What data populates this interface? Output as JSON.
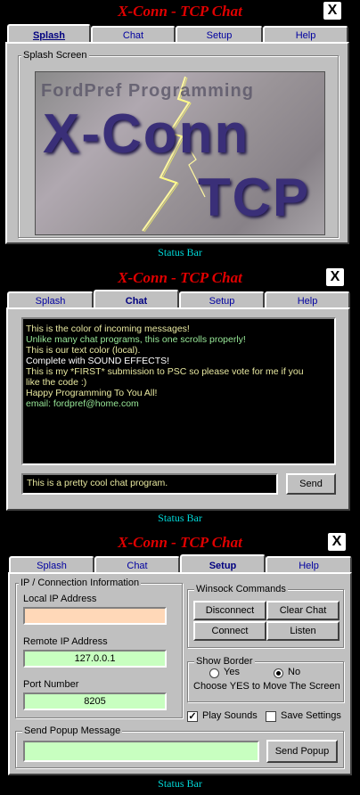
{
  "app": {
    "title": "X-Conn - TCP Chat",
    "close_label": "X",
    "status_bar": "Status Bar"
  },
  "tabs": {
    "splash": "Splash",
    "chat": "Chat",
    "setup": "Setup",
    "help": "Help"
  },
  "splash": {
    "group_label": "Splash Screen",
    "banner_top": "FordPref Programming",
    "banner_main": "X-Conn",
    "banner_sub": "TCP"
  },
  "chat": {
    "messages": [
      {
        "text": "This is the color of incoming messages!",
        "color": "#e8e8a0"
      },
      {
        "text": "Unlike many chat programs, this one scrolls properly!",
        "color": "#98e898"
      },
      {
        "text": "This is our text color (local).",
        "color": "#e8e8a0"
      },
      {
        "text": "Complete with SOUND EFFECTS!",
        "color": "#ffffff"
      },
      {
        "text": "This is my *FIRST* submission to PSC so please vote for me if you",
        "color": "#e8e8a0"
      },
      {
        "text": "like the code :)",
        "color": "#e8e8a0"
      },
      {
        "text": " Happy Programming To You All!",
        "color": "#e8e8a0"
      },
      {
        "text": " email:   fordpref@home.com",
        "color": "#98e898"
      }
    ],
    "input_value": "This is a pretty cool chat program.",
    "send_label": "Send"
  },
  "setup": {
    "ip_group_label": "IP / Connection Information",
    "local_ip_label": "Local IP Address",
    "local_ip_value": "",
    "remote_ip_label": "Remote IP Address",
    "remote_ip_value": "127.0.0.1",
    "port_label": "Port Number",
    "port_value": "8205",
    "winsock_label": "Winsock Commands",
    "disconnect_label": "Disconnect",
    "clear_chat_label": "Clear Chat",
    "connect_label": "Connect",
    "listen_label": "Listen",
    "border_label": "Show Border",
    "yes_label": "Yes",
    "no_label": "No",
    "border_selected": "No",
    "border_hint": "Choose YES to Move The Screen",
    "play_sounds_label": "Play Sounds",
    "play_sounds_checked": true,
    "save_settings_label": "Save Settings",
    "save_settings_checked": false,
    "popup_group_label": "Send Popup Message",
    "popup_value": "",
    "send_popup_label": "Send Popup"
  },
  "colors": {
    "title": "#e00000",
    "status": "#00d8d8",
    "local_field": "#ffd8b8",
    "green_field": "#c8ffc0",
    "chat_bg": "#000000"
  }
}
